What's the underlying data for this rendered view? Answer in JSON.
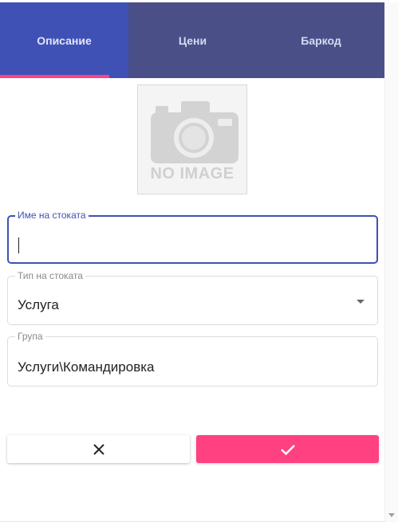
{
  "tabs": [
    {
      "label": "Описание",
      "active": true
    },
    {
      "label": "Цени",
      "active": false
    },
    {
      "label": "Баркод",
      "active": false
    }
  ],
  "image_placeholder": {
    "text": "NO IMAGE",
    "icon": "camera-icon"
  },
  "form": {
    "name": {
      "label": "Име на стоката",
      "value": ""
    },
    "type": {
      "label": "Тип на стоката",
      "value": "Услуга"
    },
    "group": {
      "label": "Група",
      "value": "Услуги\\Командировка"
    }
  },
  "actions": {
    "cancel_icon": "close-icon",
    "confirm_icon": "check-icon"
  },
  "colors": {
    "primary": "#3f51b5",
    "tab_bar": "#4a4f88",
    "accent": "#ff4081"
  }
}
